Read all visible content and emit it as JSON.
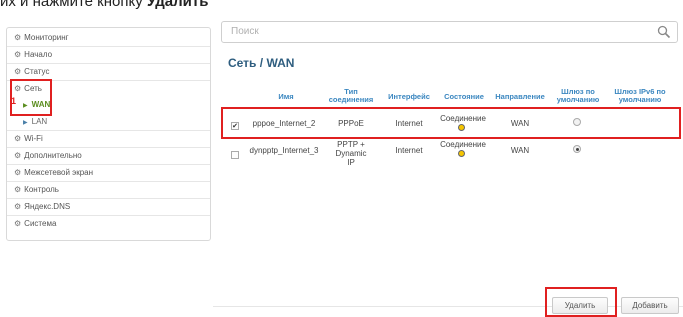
{
  "instruction": {
    "prefix": "их и нажмите кнопку ",
    "bold": "Удалить"
  },
  "sidebar": {
    "items": [
      {
        "label": "Мониторинг"
      },
      {
        "label": "Начало"
      },
      {
        "label": "Статус"
      },
      {
        "label": "Сеть"
      },
      {
        "label": "WAN"
      },
      {
        "label": "LAN"
      },
      {
        "label": "Wi-Fi"
      },
      {
        "label": "Дополнительно"
      },
      {
        "label": "Межсетевой экран"
      },
      {
        "label": "Контроль"
      },
      {
        "label": "Яндекс.DNS"
      },
      {
        "label": "Система"
      }
    ],
    "marker_1": "1"
  },
  "search": {
    "placeholder": "Поиск"
  },
  "page_title": "Сеть /  WAN",
  "table": {
    "headers": {
      "name": "Имя",
      "type": "Тип соединения",
      "interface": "Интерфейс",
      "status": "Состояние",
      "direction": "Направление",
      "gw": "Шлюз по умолчанию",
      "gw6": "Шлюз IPv6 по умолчанию"
    },
    "rows": [
      {
        "checked": true,
        "name": "pppoe_Internet_2",
        "type": "PPPoE",
        "interface": "Internet",
        "status": "Соединение",
        "status_color": "#f5c500",
        "direction": "WAN",
        "gw_selected": false
      },
      {
        "checked": false,
        "name": "dynpptp_Internet_3",
        "type": "PPTP + Dynamic IP",
        "interface": "Internet",
        "status": "Соединение",
        "status_color": "#f5c500",
        "direction": "WAN",
        "gw_selected": true
      }
    ]
  },
  "buttons": {
    "delete": "Удалить",
    "add": "Добавить"
  },
  "colors": {
    "accent": "#3b87c0",
    "highlight": "#e02020",
    "active_nav": "#5a8d1e"
  }
}
